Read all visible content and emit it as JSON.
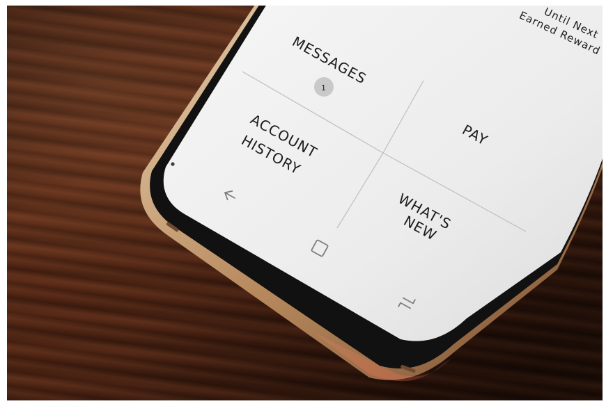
{
  "top_text": {
    "line1": "Until Next",
    "line2": "Earned Reward"
  },
  "menu": {
    "messages": {
      "label": "MESSAGES",
      "badge_count": "1"
    },
    "account_history": {
      "line1": "ACCOUNT",
      "line2": "HISTORY"
    },
    "pay": {
      "label": "PAY"
    },
    "whats_new": {
      "line1": "WHAT'S",
      "line2": "NEW"
    }
  },
  "nav_bar": {
    "back_icon": "back-arrow-icon",
    "home_icon": "home-square-icon",
    "recents_icon": "recent-apps-icon"
  },
  "colors": {
    "wood_dark": "#2e140a",
    "wood_mid": "#5a2a16",
    "screen": "#ededed",
    "badge": "#c9c9c9",
    "phone_frame": "#c9a47a"
  }
}
